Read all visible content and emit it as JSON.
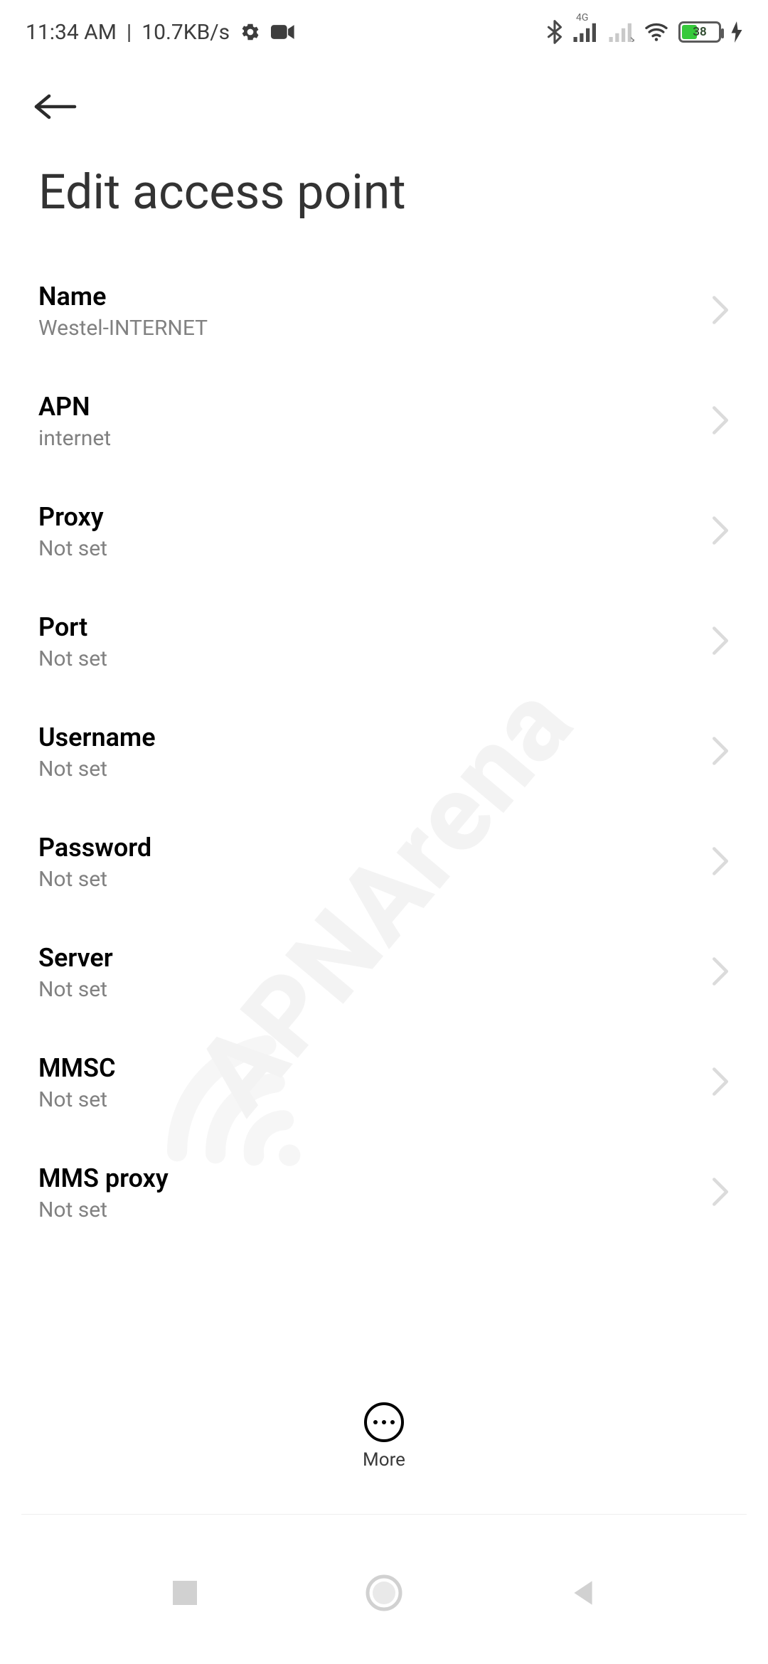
{
  "status": {
    "time": "11:34 AM",
    "speed": "10.7KB/s",
    "network_label": "4G",
    "battery_pct": "38"
  },
  "header": {
    "title": "Edit access point"
  },
  "settings": [
    {
      "label": "Name",
      "value": "Westel-INTERNET"
    },
    {
      "label": "APN",
      "value": "internet"
    },
    {
      "label": "Proxy",
      "value": "Not set"
    },
    {
      "label": "Port",
      "value": "Not set"
    },
    {
      "label": "Username",
      "value": "Not set"
    },
    {
      "label": "Password",
      "value": "Not set"
    },
    {
      "label": "Server",
      "value": "Not set"
    },
    {
      "label": "MMSC",
      "value": "Not set"
    },
    {
      "label": "MMS proxy",
      "value": "Not set"
    }
  ],
  "more_label": "More",
  "watermark": "APNArena"
}
